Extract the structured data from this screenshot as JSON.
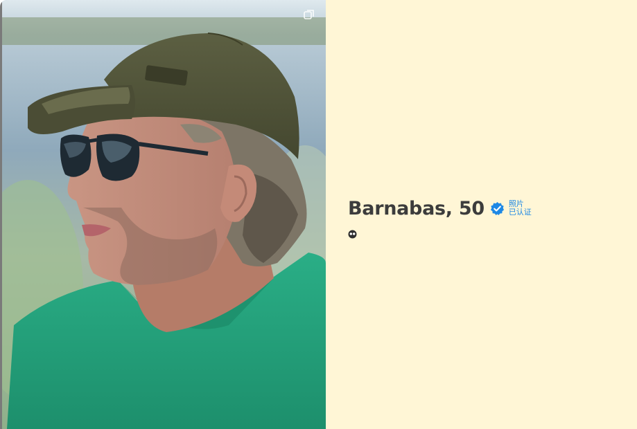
{
  "profile": {
    "name_age": "Barnabas, 50",
    "verification": {
      "line1": "照片",
      "line2": "已认证",
      "icon": "verified-check-icon",
      "color": "#1e88e5"
    },
    "badge_icon": "face-mask-icon"
  },
  "photo": {
    "icon": "expand-icon",
    "description_colors": {
      "shirt": "#23a07c",
      "cap": "#4f5238",
      "background": "#9cb7c9"
    }
  },
  "theme": {
    "info_background": "#fff6d6",
    "name_color": "#3c3c3c"
  }
}
